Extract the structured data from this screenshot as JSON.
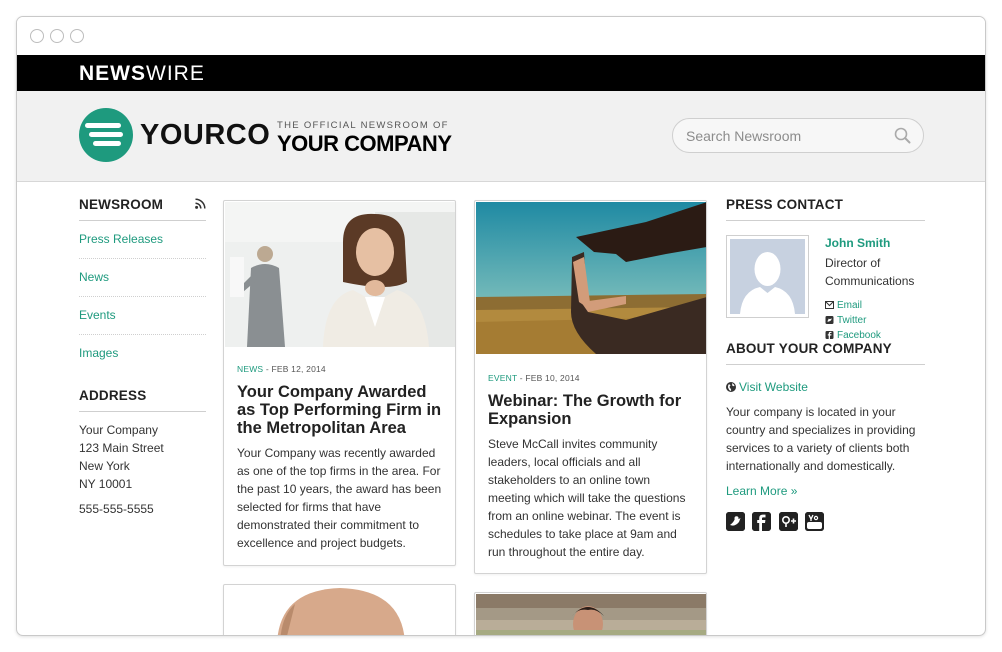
{
  "brand": {
    "bold": "NEWS",
    "light": "WIRE"
  },
  "header": {
    "logo_text": "YOURCO",
    "official_label": "THE OFFICIAL NEWSROOM OF",
    "company_name": "YOUR COMPANY",
    "search_placeholder": "Search Newsroom"
  },
  "left": {
    "newsroom_heading": "NEWSROOM",
    "nav": [
      "Press Releases",
      "News",
      "Events",
      "Images"
    ],
    "address_heading": "ADDRESS",
    "address_lines": [
      "Your Company",
      "123 Main Street",
      "New York",
      "NY 10001"
    ],
    "phone": "555-555-5555"
  },
  "cards": [
    {
      "tag": "NEWS",
      "date": " - FEB 12, 2014",
      "title": "Your Company Awarded as Top Performing Firm in the Metropolitan Area",
      "body": "Your Company was recently awarded as one of the top firms in the area. For the past 10 years, the award has been selected for firms that have demonstrated their commitment to excellence and project budgets."
    },
    {
      "tag": "EVENT",
      "date": " - FEB 10, 2014",
      "title": "Webinar: The Growth for Expansion",
      "body": "Steve McCall invites community leaders, local officials and all stakeholders to an online town meeting which will take the questions from an online webinar. The event is schedules to take place at 9am and run throughout the entire day."
    }
  ],
  "right": {
    "press_heading": "PRESS CONTACT",
    "contact_name": "John Smith",
    "contact_title": "Director of Communications",
    "links": [
      "Email",
      "Twitter",
      "Facebook"
    ],
    "about_heading": "ABOUT YOUR COMPANY",
    "visit_label": "Visit Website",
    "about_text": "Your company is located in your country and specializes in providing services to a variety of clients both internationally and domestically.",
    "learn_more": "Learn More »",
    "social_icons": [
      "twitter-icon",
      "facebook-icon",
      "google-plus-icon",
      "youtube-icon"
    ]
  },
  "colors": {
    "accent": "#1e9a7e",
    "topbar": "#000000",
    "header_bg": "#f1f1f1"
  }
}
